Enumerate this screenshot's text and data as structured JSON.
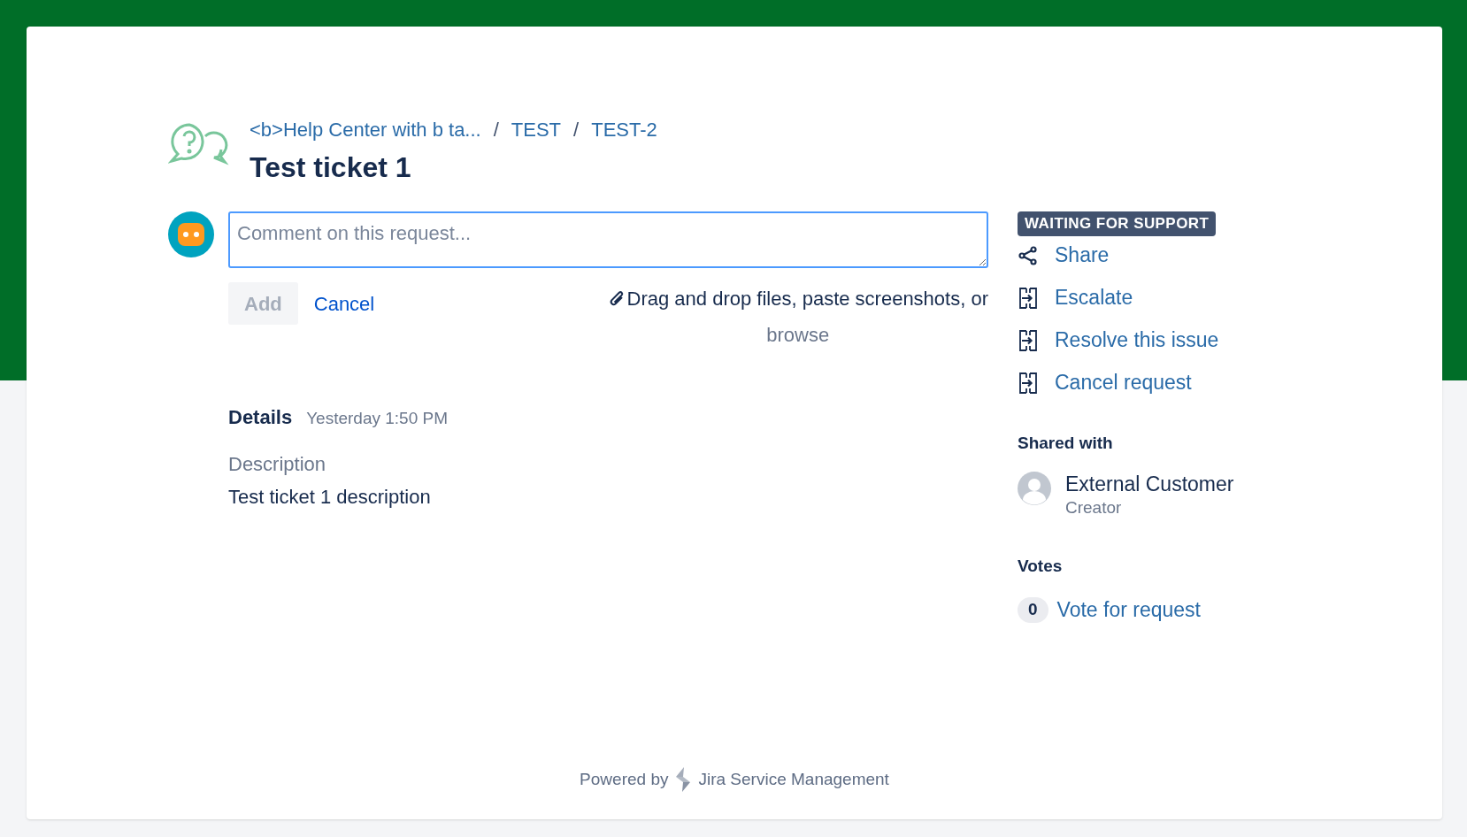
{
  "breadcrumbs": [
    "<b>Help Center with b ta...",
    "TEST",
    "TEST-2"
  ],
  "breadcrumb_separator": "/",
  "title": "Test ticket 1",
  "comment": {
    "placeholder": "Comment on this request...",
    "add_label": "Add",
    "add_disabled": true,
    "cancel_label": "Cancel",
    "attach_text": "Drag and drop files, paste screenshots, or",
    "browse_label": "browse"
  },
  "details": {
    "heading": "Details",
    "time": "Yesterday 1:50 PM",
    "description_label": "Description",
    "description": "Test ticket 1 description"
  },
  "status": "WAITING FOR SUPPORT",
  "actions": [
    {
      "kind": "share",
      "label": "Share"
    },
    {
      "kind": "transition",
      "label": "Escalate"
    },
    {
      "kind": "transition",
      "label": "Resolve this issue"
    },
    {
      "kind": "transition",
      "label": "Cancel request"
    }
  ],
  "shared_with": {
    "heading": "Shared with",
    "people": [
      {
        "name": "External Customer",
        "role": "Creator"
      }
    ]
  },
  "votes": {
    "heading": "Votes",
    "count": "0",
    "label": "Vote for request"
  },
  "footer": {
    "prefix": "Powered by",
    "product": "Jira Service Management"
  }
}
